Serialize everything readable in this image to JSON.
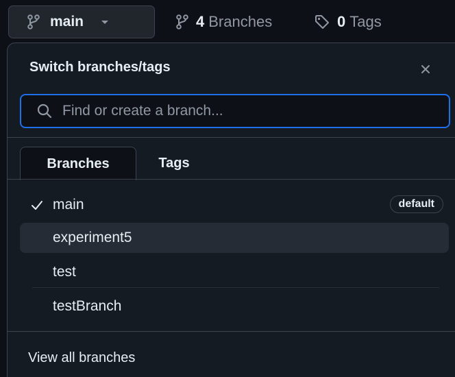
{
  "top_bar": {
    "current_branch": "main",
    "branches_count": "4",
    "branches_label": "Branches",
    "tags_count": "0",
    "tags_label": "Tags"
  },
  "dropdown": {
    "title": "Switch branches/tags",
    "search_placeholder": "Find or create a branch...",
    "tabs": [
      {
        "label": "Branches",
        "active": true
      },
      {
        "label": "Tags",
        "active": false
      }
    ],
    "branches": [
      {
        "name": "main",
        "checked": true,
        "badge": "default"
      },
      {
        "name": "experiment5",
        "checked": false,
        "hovered": true
      },
      {
        "name": "test",
        "checked": false
      },
      {
        "name": "testBranch",
        "checked": false
      }
    ],
    "footer_link": "View all branches"
  },
  "icons": {
    "branch": "git-branch-icon",
    "tag": "tag-icon",
    "search": "search-icon",
    "close": "close-icon",
    "check": "check-icon",
    "caret": "caret-down-icon"
  },
  "colors": {
    "page_bg": "#0d1117",
    "panel_bg": "#151b23",
    "border": "#3d444d",
    "focus_border": "#1f6feb",
    "muted_text": "#9198a1",
    "text": "#e6edf3",
    "hover_bg": "#262c36"
  }
}
